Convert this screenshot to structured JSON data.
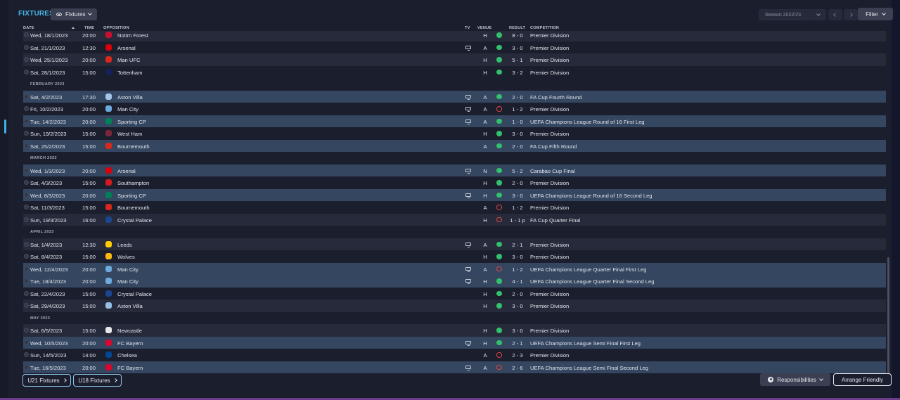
{
  "header": {
    "title": "FIXTURES",
    "view_label": "Fixtures",
    "season_label": "Season 2022/23",
    "filter_label": "Filter"
  },
  "columns": {
    "date": "DATE",
    "time": "TIME",
    "opposition": "OPPOSITION",
    "tv": "TV",
    "venue": "VENUE",
    "result": "RESULT",
    "competition": "COMPETITION"
  },
  "colors": {
    "accent": "#45b7e8",
    "win": "#33bf6b",
    "loss": "#e04646",
    "highlight_row": "#344660"
  },
  "rows": [
    {
      "kind": "match",
      "date": "Wed, 18/1/2023",
      "time": "20:00",
      "opp": "Nottm Forest",
      "crest": "#c8102e",
      "tv": false,
      "venue": "H",
      "result": "W",
      "score": "8 - 0",
      "comp": "Premier Division",
      "style": "alt"
    },
    {
      "kind": "match",
      "date": "Sat, 21/1/2023",
      "time": "12:30",
      "opp": "Arsenal",
      "crest": "#db0007",
      "tv": true,
      "venue": "A",
      "result": "W",
      "score": "3 - 0",
      "comp": "Premier Division",
      "style": ""
    },
    {
      "kind": "match",
      "date": "Wed, 25/1/2023",
      "time": "20:00",
      "opp": "Man UFC",
      "crest": "#da291c",
      "tv": false,
      "venue": "H",
      "result": "W",
      "score": "5 - 1",
      "comp": "Premier Division",
      "style": "alt"
    },
    {
      "kind": "match",
      "date": "Sat, 28/1/2023",
      "time": "15:00",
      "opp": "Tottenham",
      "crest": "#132257",
      "tv": false,
      "venue": "H",
      "result": "W",
      "score": "3 - 2",
      "comp": "Premier Division",
      "style": ""
    },
    {
      "kind": "month",
      "label": "FEBRUARY 2023"
    },
    {
      "kind": "match",
      "date": "Sat, 4/2/2023",
      "time": "17:30",
      "opp": "Aston Villa",
      "crest": "#a3c5e9",
      "tv": true,
      "venue": "A",
      "result": "W",
      "score": "2 - 0",
      "comp": "FA Cup Fourth Round",
      "style": "hl"
    },
    {
      "kind": "match",
      "date": "Fri, 10/2/2023",
      "time": "20:00",
      "opp": "Man City",
      "crest": "#6cabdd",
      "tv": true,
      "venue": "A",
      "result": "L",
      "score": "1 - 2",
      "comp": "Premier Division",
      "style": ""
    },
    {
      "kind": "match",
      "date": "Tue, 14/2/2023",
      "time": "20:00",
      "opp": "Sporting CP",
      "crest": "#008057",
      "tv": true,
      "venue": "A",
      "result": "W",
      "score": "1 - 0",
      "comp": "UEFA Champions League Round of 16 First Leg",
      "style": "hl"
    },
    {
      "kind": "match",
      "date": "Sun, 19/2/2023",
      "time": "15:00",
      "opp": "West Ham",
      "crest": "#7a263a",
      "tv": false,
      "venue": "H",
      "result": "W",
      "score": "3 - 0",
      "comp": "Premier Division",
      "style": ""
    },
    {
      "kind": "match",
      "date": "Sat, 25/2/2023",
      "time": "15:00",
      "opp": "Bournemouth",
      "crest": "#da291c",
      "tv": false,
      "venue": "A",
      "result": "W",
      "score": "2 - 0",
      "comp": "FA Cup Fifth Round",
      "style": "hl"
    },
    {
      "kind": "month",
      "label": "MARCH 2023"
    },
    {
      "kind": "match",
      "date": "Wed, 1/3/2023",
      "time": "20:00",
      "opp": "Arsenal",
      "crest": "#db0007",
      "tv": true,
      "venue": "N",
      "result": "W",
      "score": "5 - 2",
      "comp": "Carabao Cup Final",
      "style": "hl"
    },
    {
      "kind": "match",
      "date": "Sat, 4/3/2023",
      "time": "15:00",
      "opp": "Southampton",
      "crest": "#d71920",
      "tv": false,
      "venue": "H",
      "result": "W",
      "score": "2 - 0",
      "comp": "Premier Division",
      "style": ""
    },
    {
      "kind": "match",
      "date": "Wed, 8/3/2023",
      "time": "20:00",
      "opp": "Sporting CP",
      "crest": "#008057",
      "tv": true,
      "venue": "H",
      "result": "W",
      "score": "3 - 0",
      "comp": "UEFA Champions League Round of 16 Second Leg",
      "style": "hl"
    },
    {
      "kind": "match",
      "date": "Sat, 11/3/2023",
      "time": "15:00",
      "opp": "Bournemouth",
      "crest": "#da291c",
      "tv": false,
      "venue": "A",
      "result": "L",
      "score": "1 - 2",
      "comp": "Premier Division",
      "style": ""
    },
    {
      "kind": "match",
      "date": "Sun, 19/3/2023",
      "time": "16:00",
      "opp": "Crystal Palace",
      "crest": "#1b458f",
      "tv": false,
      "venue": "H",
      "result": "L",
      "score": "1 - 1 p",
      "comp": "FA Cup Quarter Final",
      "style": "alt"
    },
    {
      "kind": "month",
      "label": "APRIL 2023"
    },
    {
      "kind": "match",
      "date": "Sat, 1/4/2023",
      "time": "12:30",
      "opp": "Leeds",
      "crest": "#ffcd00",
      "tv": true,
      "venue": "A",
      "result": "W",
      "score": "2 - 1",
      "comp": "Premier Division",
      "style": "alt"
    },
    {
      "kind": "match",
      "date": "Sat, 8/4/2023",
      "time": "15:00",
      "opp": "Wolves",
      "crest": "#fdb913",
      "tv": false,
      "venue": "H",
      "result": "W",
      "score": "3 - 0",
      "comp": "Premier Division",
      "style": ""
    },
    {
      "kind": "match",
      "date": "Wed, 12/4/2023",
      "time": "20:00",
      "opp": "Man City",
      "crest": "#6cabdd",
      "tv": true,
      "venue": "A",
      "result": "L",
      "score": "1 - 2",
      "comp": "UEFA Champions League Quarter Final First Leg",
      "style": "hl"
    },
    {
      "kind": "match",
      "date": "Tue, 18/4/2023",
      "time": "20:00",
      "opp": "Man City",
      "crest": "#6cabdd",
      "tv": true,
      "venue": "H",
      "result": "W",
      "score": "4 - 1",
      "comp": "UEFA Champions League Quarter Final Second Leg",
      "style": "hl"
    },
    {
      "kind": "match",
      "date": "Sat, 22/4/2023",
      "time": "15:00",
      "opp": "Crystal Palace",
      "crest": "#1b458f",
      "tv": false,
      "venue": "H",
      "result": "W",
      "score": "2 - 0",
      "comp": "Premier Division",
      "style": ""
    },
    {
      "kind": "match",
      "date": "Sat, 29/4/2023",
      "time": "15:00",
      "opp": "Aston Villa",
      "crest": "#95bfe5",
      "tv": false,
      "venue": "H",
      "result": "W",
      "score": "3 - 0",
      "comp": "Premier Division",
      "style": "alt"
    },
    {
      "kind": "month",
      "label": "MAY 2023"
    },
    {
      "kind": "match",
      "date": "Sat, 6/5/2023",
      "time": "15:00",
      "opp": "Newcastle",
      "crest": "#e8e8e8",
      "tv": false,
      "venue": "H",
      "result": "W",
      "score": "3 - 0",
      "comp": "Premier Division",
      "style": "alt"
    },
    {
      "kind": "match",
      "date": "Wed, 10/5/2023",
      "time": "20:00",
      "opp": "FC Bayern",
      "crest": "#dc052d",
      "tv": true,
      "venue": "H",
      "result": "W",
      "score": "2 - 1",
      "comp": "UEFA Champions League Semi Final First Leg",
      "style": "hl"
    },
    {
      "kind": "match",
      "date": "Sun, 14/5/2023",
      "time": "14:00",
      "opp": "Chelsea",
      "crest": "#034694",
      "tv": false,
      "venue": "A",
      "result": "L",
      "score": "2 - 3",
      "comp": "Premier Division",
      "style": ""
    },
    {
      "kind": "match",
      "date": "Tue, 16/5/2023",
      "time": "20:00",
      "opp": "FC Bayern",
      "crest": "#dc052d",
      "tv": true,
      "venue": "A",
      "result": "L",
      "score": "2 - 6",
      "comp": "UEFA Champions League Semi Final Second Leg",
      "style": "hl"
    }
  ],
  "footer": {
    "u21_label": "U21 Fixtures",
    "u18_label": "U18 Fixtures",
    "responsibilities_label": "Responsibilities",
    "arrange_label": "Arrange Friendly"
  }
}
